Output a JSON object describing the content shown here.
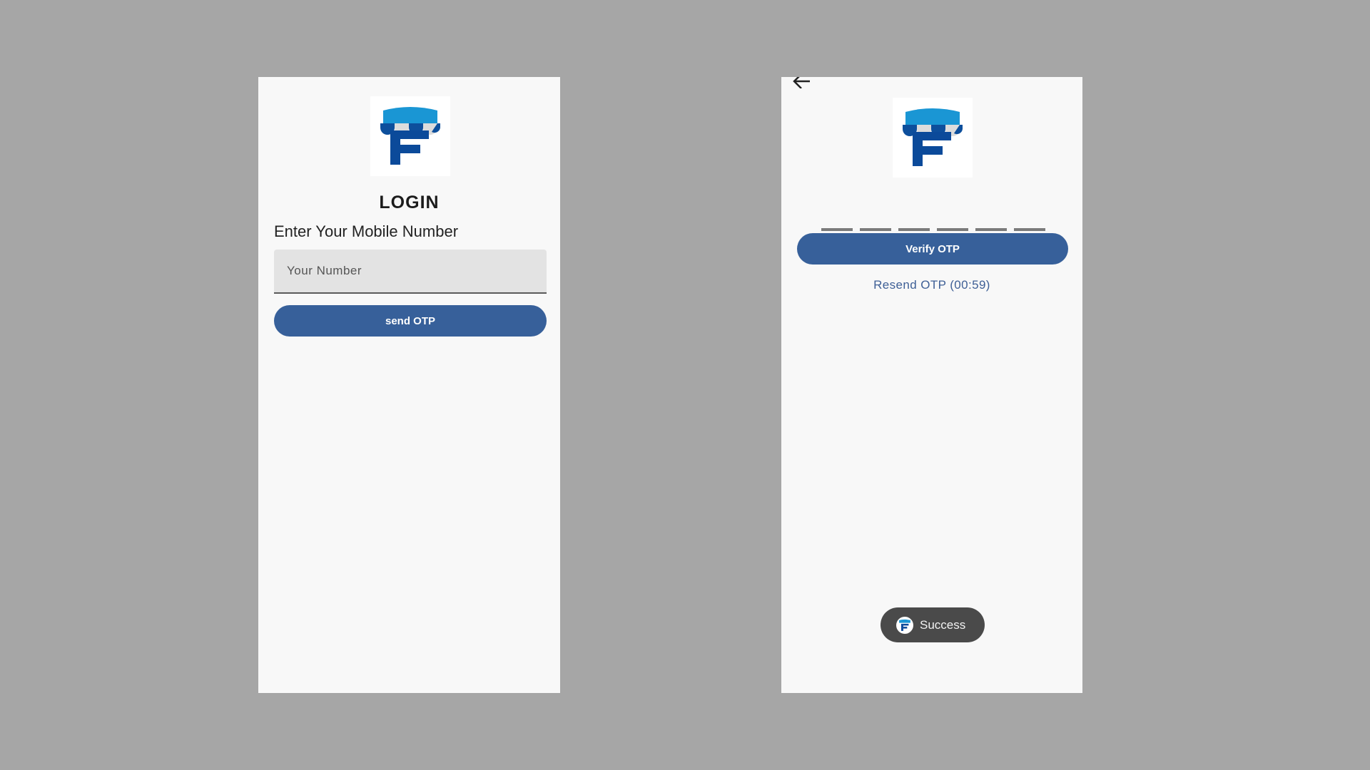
{
  "colors": {
    "backdrop": "#a6a6a6",
    "screen_bg": "#f8f8f8",
    "primary_button": "#37609a",
    "link_text": "#3e5f96",
    "logo_awning_light": "#1a96d4",
    "logo_awning_dark": "#0d4f9c",
    "logo_letter": "#0b4a9a",
    "toast_bg": "#4a4a4a"
  },
  "login_screen": {
    "logo_icon": "store-awning-f-logo-icon",
    "title": "LOGIN",
    "mobile_label": "Enter Your Mobile Number",
    "number_input": {
      "value": "",
      "placeholder": "Your Number"
    },
    "send_otp_label": "send OTP"
  },
  "otp_screen": {
    "back_icon": "back-arrow-icon",
    "logo_icon": "store-awning-f-logo-icon",
    "otp_digits": [
      "",
      "",
      "",
      "",
      "",
      ""
    ],
    "verify_label": "Verify OTP",
    "resend_label": "Resend OTP (00:59)",
    "toast": {
      "icon": "app-logo-icon",
      "text": "Success"
    }
  }
}
